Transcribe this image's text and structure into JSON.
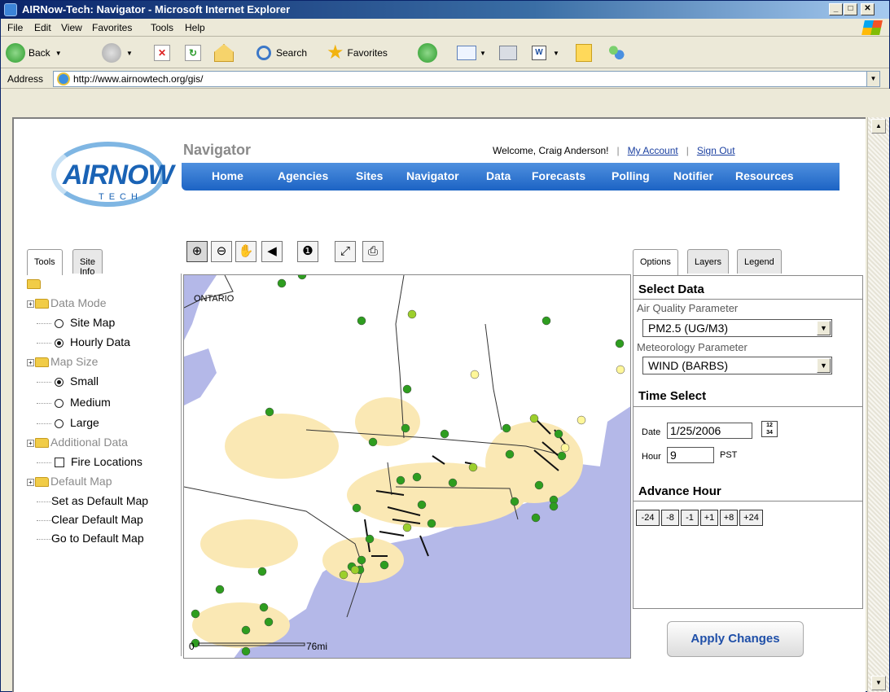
{
  "window": {
    "title": "AIRNow-Tech: Navigator - Microsoft Internet Explorer",
    "buttons": [
      "_",
      "□",
      "✕"
    ]
  },
  "menu": [
    "File",
    "Edit",
    "View",
    "Favorites",
    "Tools",
    "Help"
  ],
  "toolbar": {
    "back": "Back",
    "search": "Search",
    "favorites": "Favorites"
  },
  "address": {
    "label": "Address",
    "url": "http://www.airnowtech.org/gis/"
  },
  "header": {
    "logo_text": "AIRNOW",
    "logo_sub": "TECH",
    "page_title": "Navigator",
    "welcome": "Welcome, Craig Anderson!",
    "my_account": "My Account",
    "sign_out": "Sign Out",
    "separator": "|"
  },
  "nav": [
    "Home",
    "Agencies",
    "Sites",
    "Navigator",
    "Data",
    "Forecasts",
    "Polling",
    "Notifier",
    "Resources"
  ],
  "left_tabs": [
    "Tools",
    "Site Info"
  ],
  "tree": {
    "data_mode": "Data Mode",
    "site_map": "Site Map",
    "hourly_data": "Hourly Data",
    "map_size": "Map Size",
    "small": "Small",
    "medium": "Medium",
    "large": "Large",
    "additional_data": "Additional Data",
    "fire_locations": "Fire Locations",
    "default_map": "Default Map",
    "set_default": "Set as Default Map",
    "clear_default": "Clear Default Map",
    "go_default": "Go to Default Map"
  },
  "map": {
    "region_label": "ONTARIO",
    "scale_start": "0",
    "scale_end": "76mi"
  },
  "right_tabs": [
    "Options",
    "Layers",
    "Legend"
  ],
  "options": {
    "select_data": "Select Data",
    "aq_param_label": "Air Quality Parameter",
    "aq_param_value": "PM2.5 (UG/M3)",
    "met_param_label": "Meteorology Parameter",
    "met_param_value": "WIND (BARBS)",
    "time_select": "Time Select",
    "date_label": "Date",
    "date_value": "1/25/2006",
    "hour_label": "Hour",
    "hour_value": "9",
    "tz": "PST",
    "advance_hour": "Advance Hour",
    "advance_buttons": [
      "-24",
      "-8",
      "-1",
      "+1",
      "+8",
      "+24"
    ],
    "apply": "Apply Changes"
  },
  "colors": {
    "title_bar": "#0a246a",
    "nav_bar": "#1c63c4",
    "water": "#b4b8e8",
    "land": "#ffffff",
    "urban": "#fae8b4",
    "site_good": "#2e9d1f",
    "site_moderate_low": "#9ccf2c",
    "site_moderate": "#fff79a"
  }
}
